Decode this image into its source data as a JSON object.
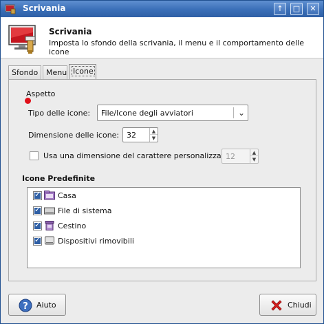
{
  "window": {
    "title": "Scrivania"
  },
  "titlebar_buttons": {
    "up": "↑",
    "maximize": "□",
    "close": "✕"
  },
  "header": {
    "title": "Scrivania",
    "subtitle": "Imposta lo sfondo della scrivania, il menu e il comportamento delle icone"
  },
  "tabs": [
    {
      "label": "Sfondo",
      "active": false
    },
    {
      "label": "Menu",
      "active": false
    },
    {
      "label": "Icone",
      "active": true
    }
  ],
  "aspetto": {
    "section_label": "Aspetto",
    "type_label": "Tipo delle icone:",
    "type_value": "File/Icone degli avviatori",
    "size_label": "Dimensione delle icone:",
    "size_value": "32",
    "custom_font_label": "Usa una dimensione del carattere personalizzata:",
    "custom_font_checked": false,
    "custom_font_value": "12"
  },
  "default_icons": {
    "section_label": "Icone Predefinite",
    "items": [
      {
        "label": "Casa",
        "checked": true,
        "icon": "home-folder-icon"
      },
      {
        "label": "File di sistema",
        "checked": true,
        "icon": "drive-icon"
      },
      {
        "label": "Cestino",
        "checked": true,
        "icon": "trash-icon"
      },
      {
        "label": "Dispositivi rimovibili",
        "checked": true,
        "icon": "removable-drive-icon"
      }
    ]
  },
  "footer": {
    "help_label": "Aiuto",
    "close_label": "Chiudi"
  },
  "colors": {
    "titlebar": "#3a6fb8",
    "accent": "#2f5fa5",
    "close_icon": "#d81e1e",
    "help_icon": "#3d6fbf",
    "marker": "#e0101a"
  }
}
